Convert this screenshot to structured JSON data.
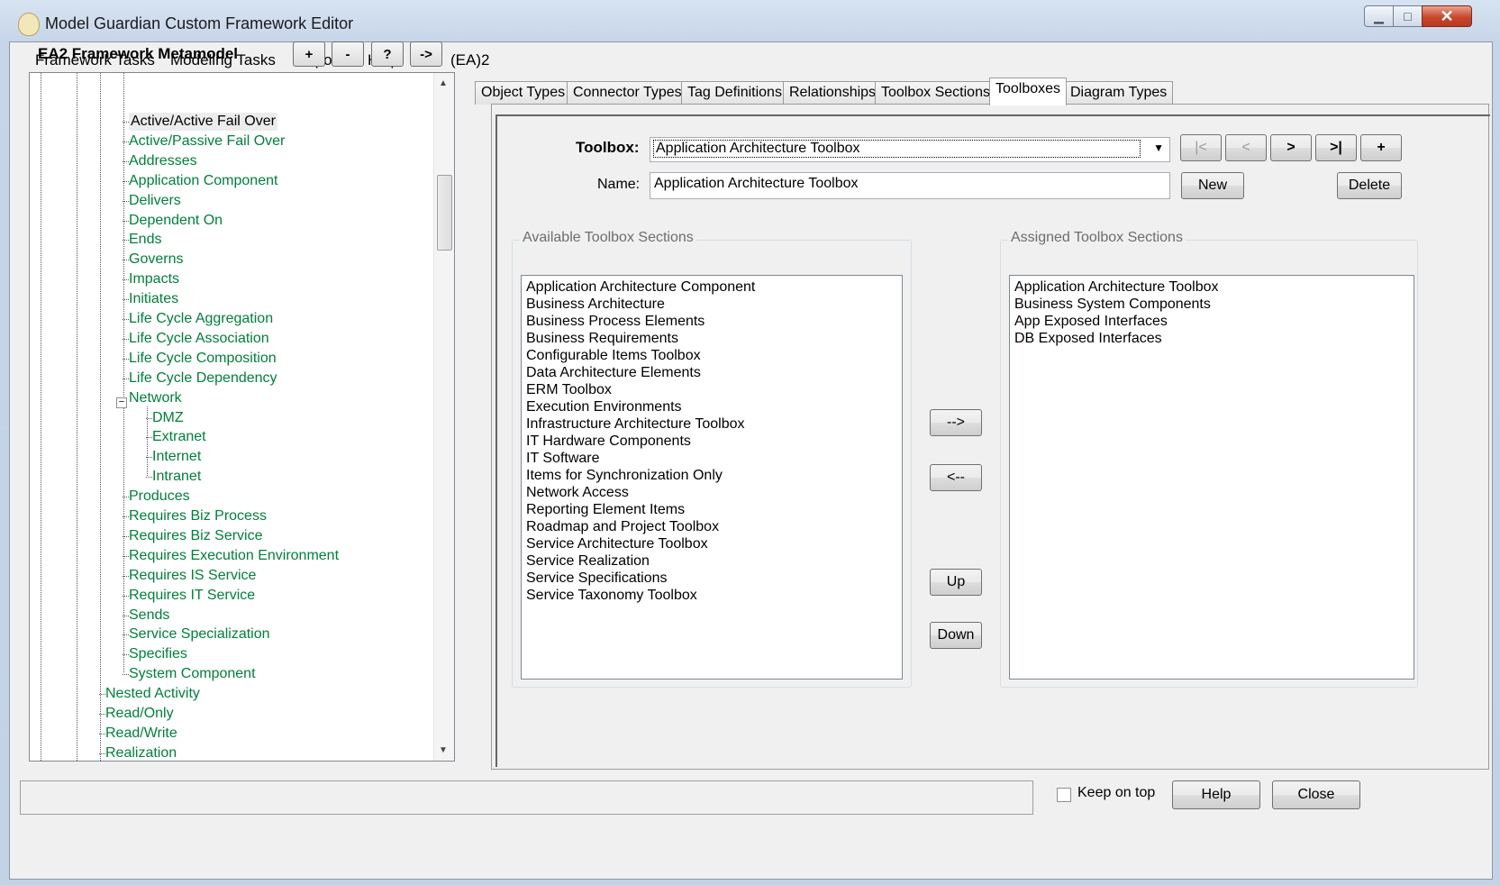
{
  "window": {
    "title": "Model Guardian Custom Framework Editor"
  },
  "menu": {
    "items": [
      "Framework Tasks",
      "Modeling Tasks",
      "Reports",
      "Help",
      "/",
      "(EA)2"
    ]
  },
  "left": {
    "title": "EA2 Framework Metamodel",
    "buttons": [
      "+",
      "-",
      "?",
      "->"
    ],
    "tree": [
      "Active/Active Fail Over",
      "Active/Passive Fail Over",
      "Addresses",
      "Application Component",
      "Delivers",
      "Dependent On",
      "Ends",
      "Governs",
      "Impacts",
      "Initiates",
      "Life Cycle Aggregation",
      "Life Cycle Association",
      "Life Cycle Composition",
      "Life Cycle Dependency",
      "Network",
      "DMZ",
      "Extranet",
      "Internet",
      "Intranet",
      "Produces",
      "Requires Biz Process",
      "Requires Biz Service",
      "Requires Execution Environment",
      "Requires IS Service",
      "Requires IT Service",
      "Sends",
      "Service Specialization",
      "Specifies",
      "System Component",
      "Nested Activity",
      "Read/Only",
      "Read/Write",
      "Realization"
    ]
  },
  "tabs": [
    "Object Types",
    "Connector Types",
    "Tag Definitions",
    "Relationships",
    "Toolbox Sections",
    "Toolboxes",
    "Diagram Types"
  ],
  "active_tab": "Toolboxes",
  "toolbox": {
    "label": "Toolbox:",
    "selected": "Application Architecture Toolbox",
    "nav_buttons": [
      "|<",
      "<",
      ">",
      ">|",
      "+"
    ],
    "name_label": "Name:",
    "name_value": "Application Architecture Toolbox",
    "new_label": "New",
    "delete_label": "Delete"
  },
  "available": {
    "title": "Available Toolbox Sections",
    "items": [
      "Application Architecture Component",
      "Business Architecture",
      "Business Process Elements",
      "Business Requirements",
      "Configurable Items Toolbox",
      "Data Architecture Elements",
      "ERM Toolbox",
      "Execution Environments",
      "Infrastructure Architecture Toolbox",
      "IT Hardware Components",
      "IT Software",
      "Items for Synchronization Only",
      "Network Access",
      "Reporting Element Items",
      "Roadmap and Project Toolbox",
      "Service Architecture Toolbox",
      "Service Realization",
      "Service Specifications",
      "Service Taxonomy Toolbox"
    ]
  },
  "assigned": {
    "title": "Assigned Toolbox Sections",
    "items": [
      "Application Architecture Toolbox",
      "Business System Components",
      "App Exposed Interfaces",
      "DB Exposed Interfaces"
    ]
  },
  "move_buttons": {
    "add": "-->",
    "remove": "<--",
    "up": "Up",
    "down": "Down"
  },
  "footer": {
    "keep_on_top": "Keep on top",
    "help": "Help",
    "close": "Close"
  }
}
